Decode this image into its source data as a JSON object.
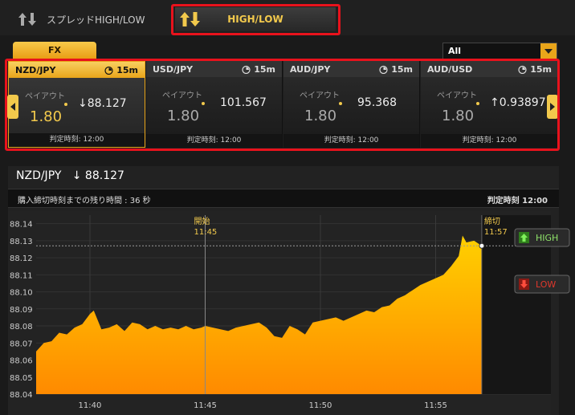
{
  "tabs": {
    "spread_label": "スプレッドHIGH/LOW",
    "highlow_label": "HIGH/LOW"
  },
  "category_tab": "FX",
  "filter": {
    "selected": "All"
  },
  "cards": [
    {
      "pair": "NZD/JPY",
      "duration": "15m",
      "payout_label": "ペイアウト",
      "payout": "1.80",
      "rate": "↓88.127",
      "deadline": "判定時刻: 12:00"
    },
    {
      "pair": "USD/JPY",
      "duration": "15m",
      "payout_label": "ペイアウト",
      "payout": "1.80",
      "rate": "101.567",
      "deadline": "判定時刻: 12:00"
    },
    {
      "pair": "AUD/JPY",
      "duration": "15m",
      "payout_label": "ペイアウト",
      "payout": "1.80",
      "rate": "95.368",
      "deadline": "判定時刻: 12:00"
    },
    {
      "pair": "AUD/USD",
      "duration": "15m",
      "payout_label": "ペイアウト",
      "payout": "1.80",
      "rate": "↑0.93897",
      "deadline": "判定時刻: 12:00"
    }
  ],
  "chart_panel": {
    "pair": "NZD/JPY",
    "rate": "↓ 88.127",
    "remaining": "購入締切時刻までの残り時間 : 36 秒",
    "deadline": "判定時刻 12:00",
    "start_label": "開始",
    "start_time": "11:45",
    "close_label": "締切",
    "close_time": "11:57",
    "high_button": "HIGH",
    "low_button": "LOW"
  },
  "chart_data": {
    "type": "area",
    "x_label": "",
    "y_label": "",
    "xticks": [
      "11:40",
      "11:45",
      "11:50",
      "11:55"
    ],
    "yticks": [
      "88.04",
      "88.05",
      "88.06",
      "88.07",
      "88.08",
      "88.09",
      "88.10",
      "88.11",
      "88.12",
      "88.13",
      "88.14"
    ],
    "ylim": [
      88.04,
      88.145
    ],
    "xlim": [
      "11:37:40",
      "12:00:00"
    ],
    "current_rate": 88.127,
    "series": [
      {
        "x": [
          "11:37:40",
          "11:38:00",
          "11:38:20",
          "11:38:40",
          "11:39:00",
          "11:39:20",
          "11:39:40",
          "11:40:00",
          "11:40:10",
          "11:40:30",
          "11:40:50",
          "11:41:10",
          "11:41:30",
          "11:41:50",
          "11:42:10",
          "11:42:30",
          "11:42:50",
          "11:43:10",
          "11:43:30",
          "11:43:50",
          "11:44:10",
          "11:44:30",
          "11:44:50",
          "11:45:00",
          "11:45:20",
          "11:45:40",
          "11:46:00",
          "11:46:20",
          "11:46:40",
          "11:47:00",
          "11:47:20",
          "11:47:40",
          "11:48:00",
          "11:48:20",
          "11:48:40",
          "11:49:00",
          "11:49:20",
          "11:49:40",
          "11:50:00",
          "11:50:20",
          "11:50:40",
          "11:51:00",
          "11:51:20",
          "11:51:40",
          "11:52:00",
          "11:52:20",
          "11:52:40",
          "11:53:00",
          "11:53:20",
          "11:53:40",
          "11:54:00",
          "11:54:20",
          "11:54:40",
          "11:55:00",
          "11:55:20",
          "11:55:40",
          "11:56:00",
          "11:56:10",
          "11:56:20",
          "11:56:40",
          "11:57:00"
        ],
        "y": [
          88.065,
          88.07,
          88.071,
          88.076,
          88.075,
          88.079,
          88.081,
          88.087,
          88.089,
          88.078,
          88.079,
          88.081,
          88.077,
          88.082,
          88.081,
          88.078,
          88.08,
          88.078,
          88.079,
          88.078,
          88.08,
          88.078,
          88.079,
          88.08,
          88.079,
          88.078,
          88.077,
          88.079,
          88.08,
          88.081,
          88.082,
          88.079,
          88.074,
          88.073,
          88.08,
          88.078,
          88.075,
          88.082,
          88.083,
          88.084,
          88.085,
          88.083,
          88.085,
          88.087,
          88.089,
          88.088,
          88.091,
          88.092,
          88.096,
          88.098,
          88.101,
          88.104,
          88.106,
          88.108,
          88.11,
          88.115,
          88.121,
          88.133,
          88.129,
          88.13,
          88.127
        ]
      }
    ]
  }
}
